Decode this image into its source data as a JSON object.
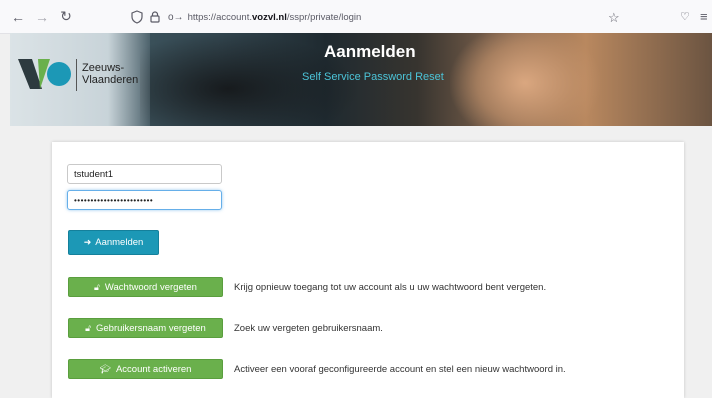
{
  "browser": {
    "url_prefix": "https://account.",
    "url_domain": "vozvl.nl",
    "url_path": "/sspr/private/login"
  },
  "logo": {
    "line1": "Zeeuws-",
    "line2": "Vlaanderen",
    "colors": {
      "dark": "#2d3a3f",
      "green": "#6ab04c",
      "teal": "#1c98b6"
    }
  },
  "hero": {
    "title": "Aanmelden",
    "subtitle": "Self Service Password Reset"
  },
  "form": {
    "username_value": "tstudent1",
    "password_value": "••••••••••••••••••••••••",
    "login_label": "Aanmelden"
  },
  "actions": [
    {
      "label": "Wachtwoord vergeten",
      "description": "Krijg opnieuw toegang tot uw account als u uw wachtwoord bent vergeten."
    },
    {
      "label": "Gebruikersnaam vergeten",
      "description": "Zoek uw vergeten gebruikersnaam."
    },
    {
      "label": "Account activeren",
      "description": "Activeer een vooraf geconfigureerde account en stel een nieuw wachtwoord in."
    }
  ],
  "icons": {
    "back": "back-arrow-icon",
    "forward": "forward-arrow-icon",
    "reload": "reload-icon",
    "login": "sign-in-icon",
    "unlock": "unlock-icon",
    "graduation": "graduation-cap-icon"
  },
  "colors": {
    "primary_button": "#1c98b6",
    "action_button": "#6ab04c",
    "subtitle": "#4cc4d8"
  }
}
